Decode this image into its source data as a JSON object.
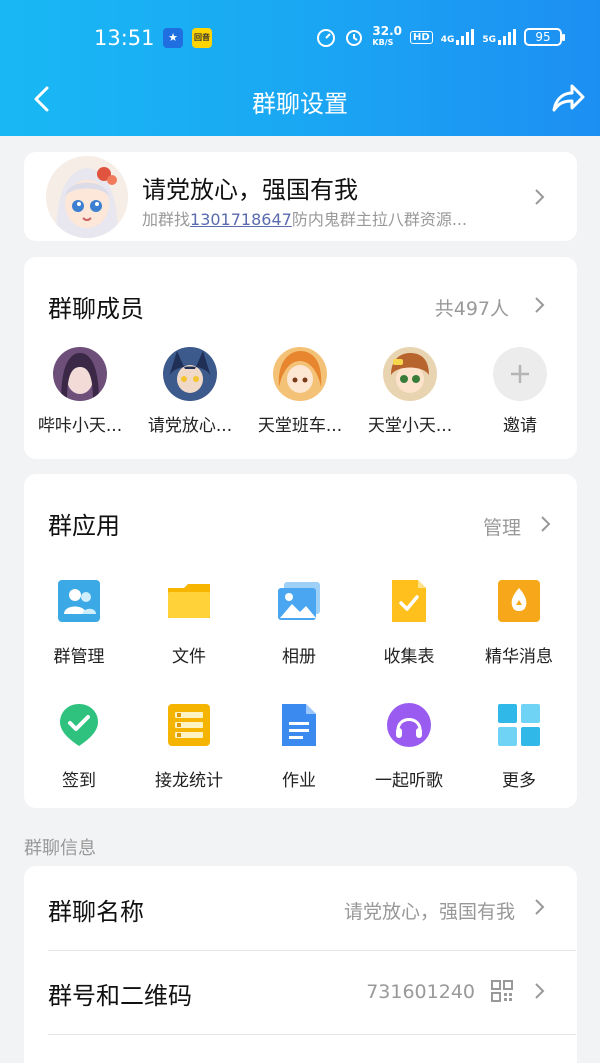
{
  "status_bar": {
    "time": "13:51",
    "app_icon_2": "回音",
    "speed_value": "32.0",
    "speed_unit": "KB/S",
    "hd": "HD",
    "net1": "4G",
    "net2": "5G",
    "battery": "95"
  },
  "header": {
    "title": "群聊设置"
  },
  "profile": {
    "name": "请党放心，强国有我",
    "desc_prefix": "加群找",
    "desc_number": "1301718647",
    "desc_suffix": "防内鬼群主拉八群资源..."
  },
  "members": {
    "title": "群聊成员",
    "count": "共497人",
    "list": [
      {
        "name": "哔咔小天...",
        "color": "#6d4f7a"
      },
      {
        "name": "请党放心...",
        "color": "#3c5a8c"
      },
      {
        "name": "天堂班车...",
        "color": "#e8a24a"
      },
      {
        "name": "天堂小天...",
        "color": "#c98b43"
      }
    ],
    "invite_label": "邀请"
  },
  "apps": {
    "title": "群应用",
    "manage": "管理",
    "items": [
      {
        "label": "群管理",
        "icon": "group-manage-icon"
      },
      {
        "label": "文件",
        "icon": "folder-icon"
      },
      {
        "label": "相册",
        "icon": "album-icon"
      },
      {
        "label": "收集表",
        "icon": "collect-form-icon"
      },
      {
        "label": "精华消息",
        "icon": "essence-icon"
      },
      {
        "label": "签到",
        "icon": "check-in-icon"
      },
      {
        "label": "接龙统计",
        "icon": "solitaire-icon"
      },
      {
        "label": "作业",
        "icon": "homework-icon"
      },
      {
        "label": "一起听歌",
        "icon": "headphones-icon"
      },
      {
        "label": "更多",
        "icon": "more-grid-icon"
      }
    ]
  },
  "info": {
    "section_label": "群聊信息",
    "group_name_label": "群聊名称",
    "group_name_value": "请党放心，强国有我",
    "group_id_label": "群号和二维码",
    "group_id_value": "731601240"
  },
  "colors": {
    "header_gradient_start": "#19b8f4",
    "header_gradient_end": "#1d8ff3",
    "link": "#5a6bb0"
  }
}
